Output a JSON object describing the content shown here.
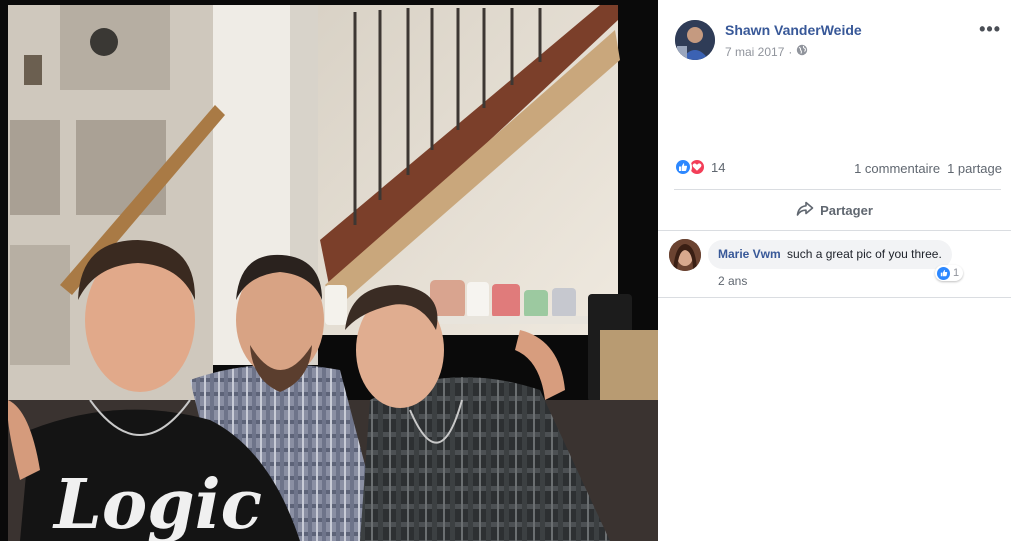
{
  "post": {
    "author": "Shawn VanderWeide",
    "date": "7 mai 2017",
    "separator": "·",
    "privacy_icon": "globe-icon",
    "more_label": "•••"
  },
  "reactions": {
    "types": [
      "like-icon",
      "love-icon"
    ],
    "count": "14"
  },
  "stats": {
    "comments": "1 commentaire",
    "shares": "1 partage"
  },
  "actions": {
    "share_label": "Partager",
    "share_icon": "share-arrow-icon"
  },
  "comments": [
    {
      "name": "Marie Vwm",
      "text": "such a great pic of you three.",
      "time": "2 ans",
      "reaction_count": "1",
      "reaction_icon": "like-icon"
    }
  ],
  "photo": {
    "shirt_text": "Logic"
  },
  "colors": {
    "link_blue": "#385898",
    "like_blue": "#2d88ff",
    "love_red": "#f33e58",
    "muted_text": "#606770",
    "divider": "#dadde1",
    "photo_bg": "#000000"
  }
}
